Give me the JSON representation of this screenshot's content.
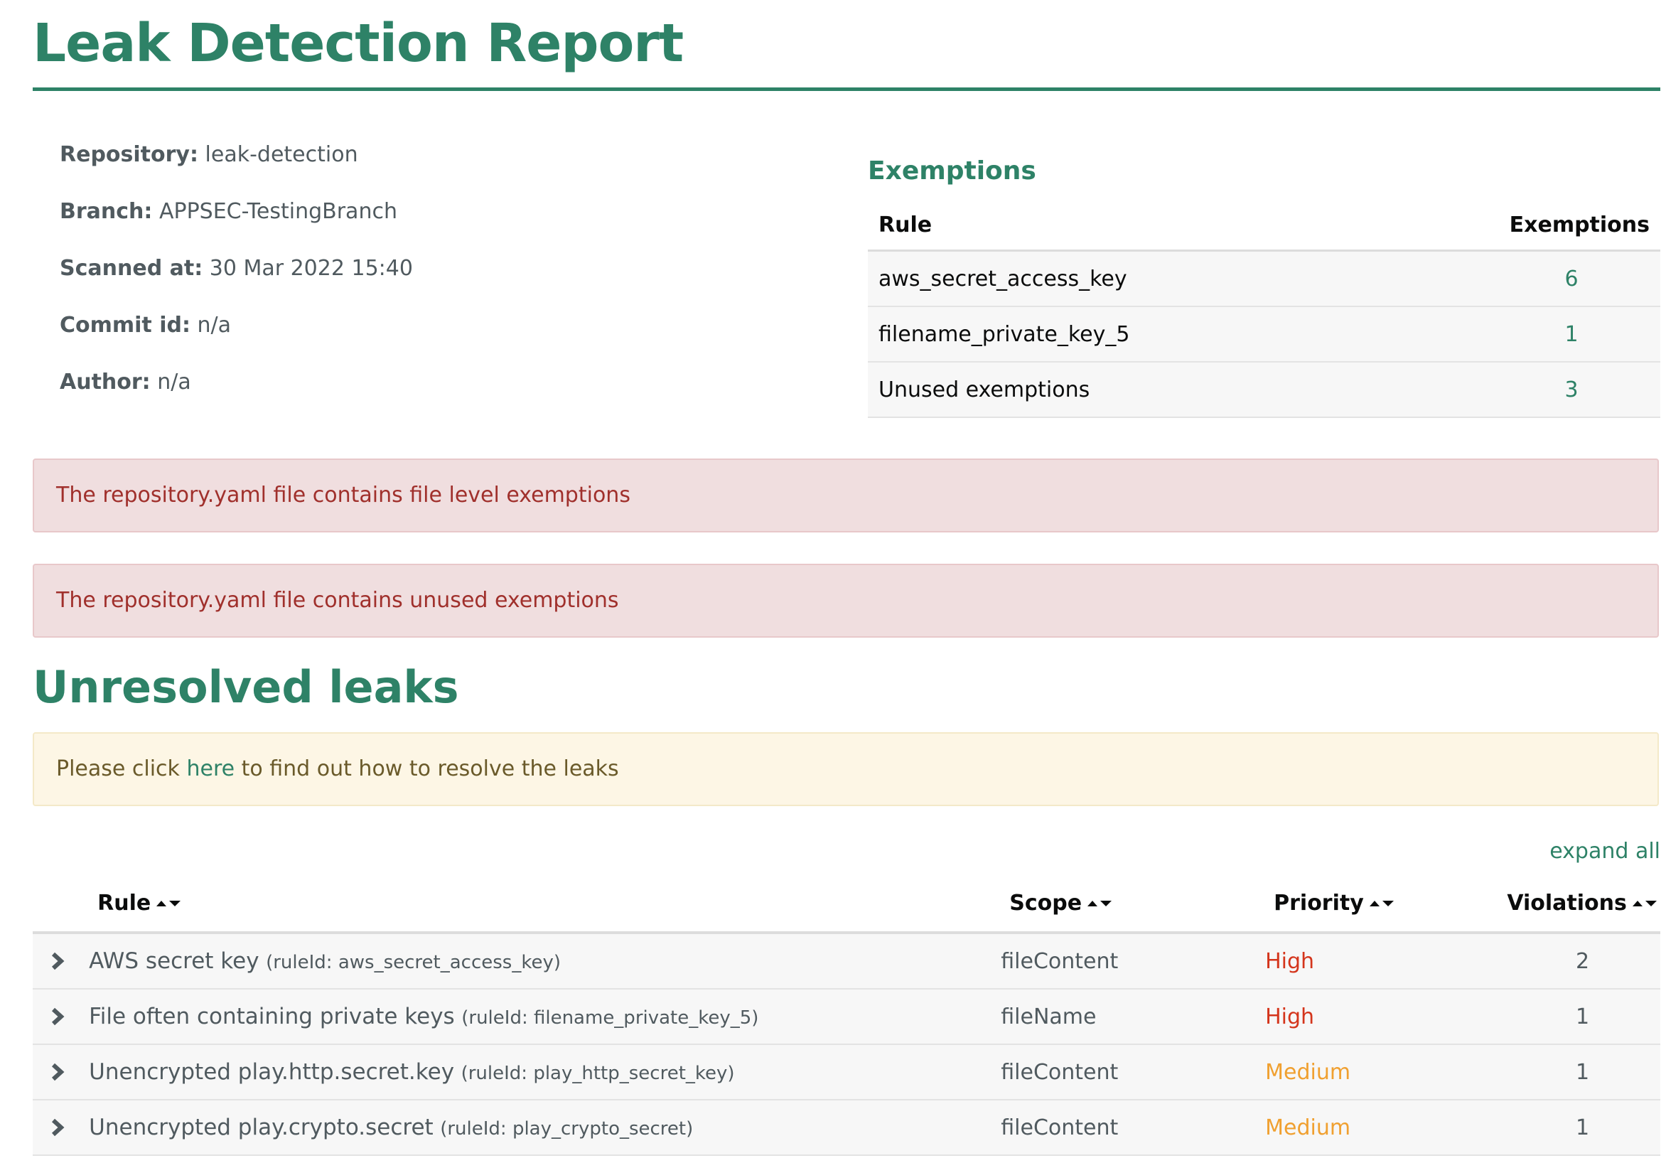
{
  "title": "Leak Detection Report",
  "meta": [
    {
      "label": "Repository:",
      "value": "leak-detection"
    },
    {
      "label": "Branch:",
      "value": "APPSEC-TestingBranch"
    },
    {
      "label": "Scanned at:",
      "value": "30 Mar 2022 15:40"
    },
    {
      "label": "Commit id:",
      "value": "n/a"
    },
    {
      "label": "Author:",
      "value": "n/a"
    }
  ],
  "exemptions": {
    "heading": "Exemptions",
    "columns": [
      "Rule",
      "Exemptions"
    ],
    "rows": [
      {
        "rule": "aws_secret_access_key",
        "count": "6"
      },
      {
        "rule": "filename_private_key_5",
        "count": "1"
      },
      {
        "rule": "Unused exemptions",
        "count": "3"
      }
    ]
  },
  "alerts": [
    "The repository.yaml file contains file level exemptions",
    "The repository.yaml file contains unused exemptions"
  ],
  "unresolved": {
    "heading": "Unresolved leaks",
    "info_prefix": "Please click ",
    "info_link": "here",
    "info_suffix": " to find out how to resolve the leaks",
    "expand_all": "expand all",
    "columns": [
      "Rule",
      "Scope",
      "Priority",
      "Violations"
    ],
    "rows": [
      {
        "name": "AWS secret key",
        "rule_id": "(ruleId: aws_secret_access_key)",
        "scope": "fileContent",
        "priority": "High",
        "violations": "2"
      },
      {
        "name": "File often containing private keys",
        "rule_id": "(ruleId: filename_private_key_5)",
        "scope": "fileName",
        "priority": "High",
        "violations": "1"
      },
      {
        "name": "Unencrypted play.http.secret.key",
        "rule_id": "(ruleId: play_http_secret_key)",
        "scope": "fileContent",
        "priority": "Medium",
        "violations": "1"
      },
      {
        "name": "Unencrypted play.crypto.secret",
        "rule_id": "(ruleId: play_crypto_secret)",
        "scope": "fileContent",
        "priority": "Medium",
        "violations": "1"
      }
    ]
  },
  "colors": {
    "brand_green": "#2e8267",
    "alert_bg": "#f0dedf",
    "alert_text": "#a0302c",
    "info_bg": "#fdf6e5",
    "priority_high": "#d4351c",
    "priority_medium": "#f0a030"
  }
}
